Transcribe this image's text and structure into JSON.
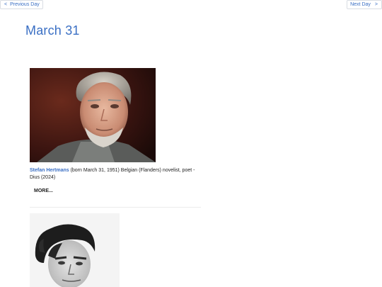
{
  "nav": {
    "prev_label": "Previous Day",
    "next_label": "Next Day",
    "prev_icon": "chevron-left-icon",
    "next_icon": "chevron-right-icon"
  },
  "page": {
    "title": "March 31"
  },
  "entries": [
    {
      "author": "Stefan Hertmans",
      "description": " (born March 31, 1951) Belgian (Flanders) novelist, poet - Dius (2024)",
      "more_label": "MORE...",
      "photo": "author-portrait-photo"
    },
    {
      "photo": "author-portrait-photo-bw"
    }
  ],
  "colors": {
    "link": "#3a6fc4",
    "text": "#222222",
    "divider": "#ececec"
  }
}
